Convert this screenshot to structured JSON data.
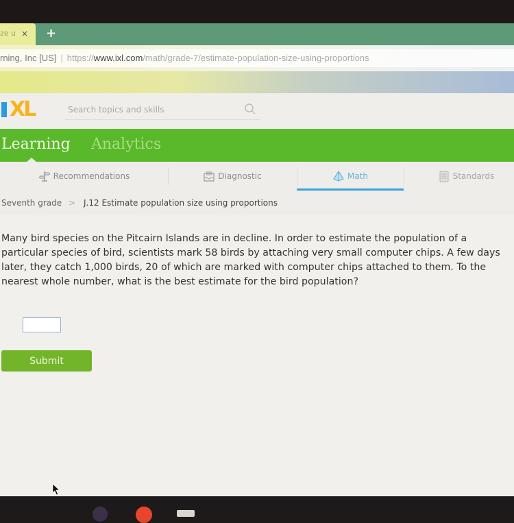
{
  "browser": {
    "tab": {
      "title": "ze u",
      "close_glyph": "×"
    },
    "new_tab_glyph": "+",
    "address_bar": {
      "org": "rning, Inc [US]",
      "separator": "|",
      "scheme": "https://",
      "host": "www.ixl.com",
      "path": "/math/grade-7/estimate-population-size-using-proportions"
    }
  },
  "header": {
    "logo_text": "XL",
    "search": {
      "placeholder": "Search topics and skills",
      "value": ""
    }
  },
  "main_nav": {
    "items": [
      {
        "label": "Learning",
        "active": true
      },
      {
        "label": "Analytics",
        "active": false
      }
    ]
  },
  "sub_nav": {
    "tabs": [
      {
        "label": "Recommendations",
        "icon": "signpost-icon",
        "active": false
      },
      {
        "label": "Diagnostic",
        "icon": "diagnostic-icon",
        "active": false
      },
      {
        "label": "Math",
        "icon": "pyramid-icon",
        "active": true
      },
      {
        "label": "Standards",
        "icon": "clipboard-icon",
        "active": false
      }
    ]
  },
  "breadcrumb": {
    "grade": "Seventh grade",
    "separator": ">",
    "skill": "J.12 Estimate population size using proportions"
  },
  "problem": {
    "text": "Many bird species on the Pitcairn Islands are in decline. In order to estimate the population of a particular species of bird, scientists mark 58 birds by attaching very small computer chips. A few days later, they catch 1,000 birds, 20 of which are marked with computer chips attached to them. To the nearest whole number, what is the best estimate for the bird population?",
    "answer_value": "",
    "submit_label": "Submit"
  },
  "colors": {
    "brand_green": "#5ab92a",
    "submit_green": "#72b52a",
    "active_tab_blue": "#3aa0d6",
    "logo_blue": "#2a9be0",
    "logo_yellow": "#f5b41e"
  }
}
